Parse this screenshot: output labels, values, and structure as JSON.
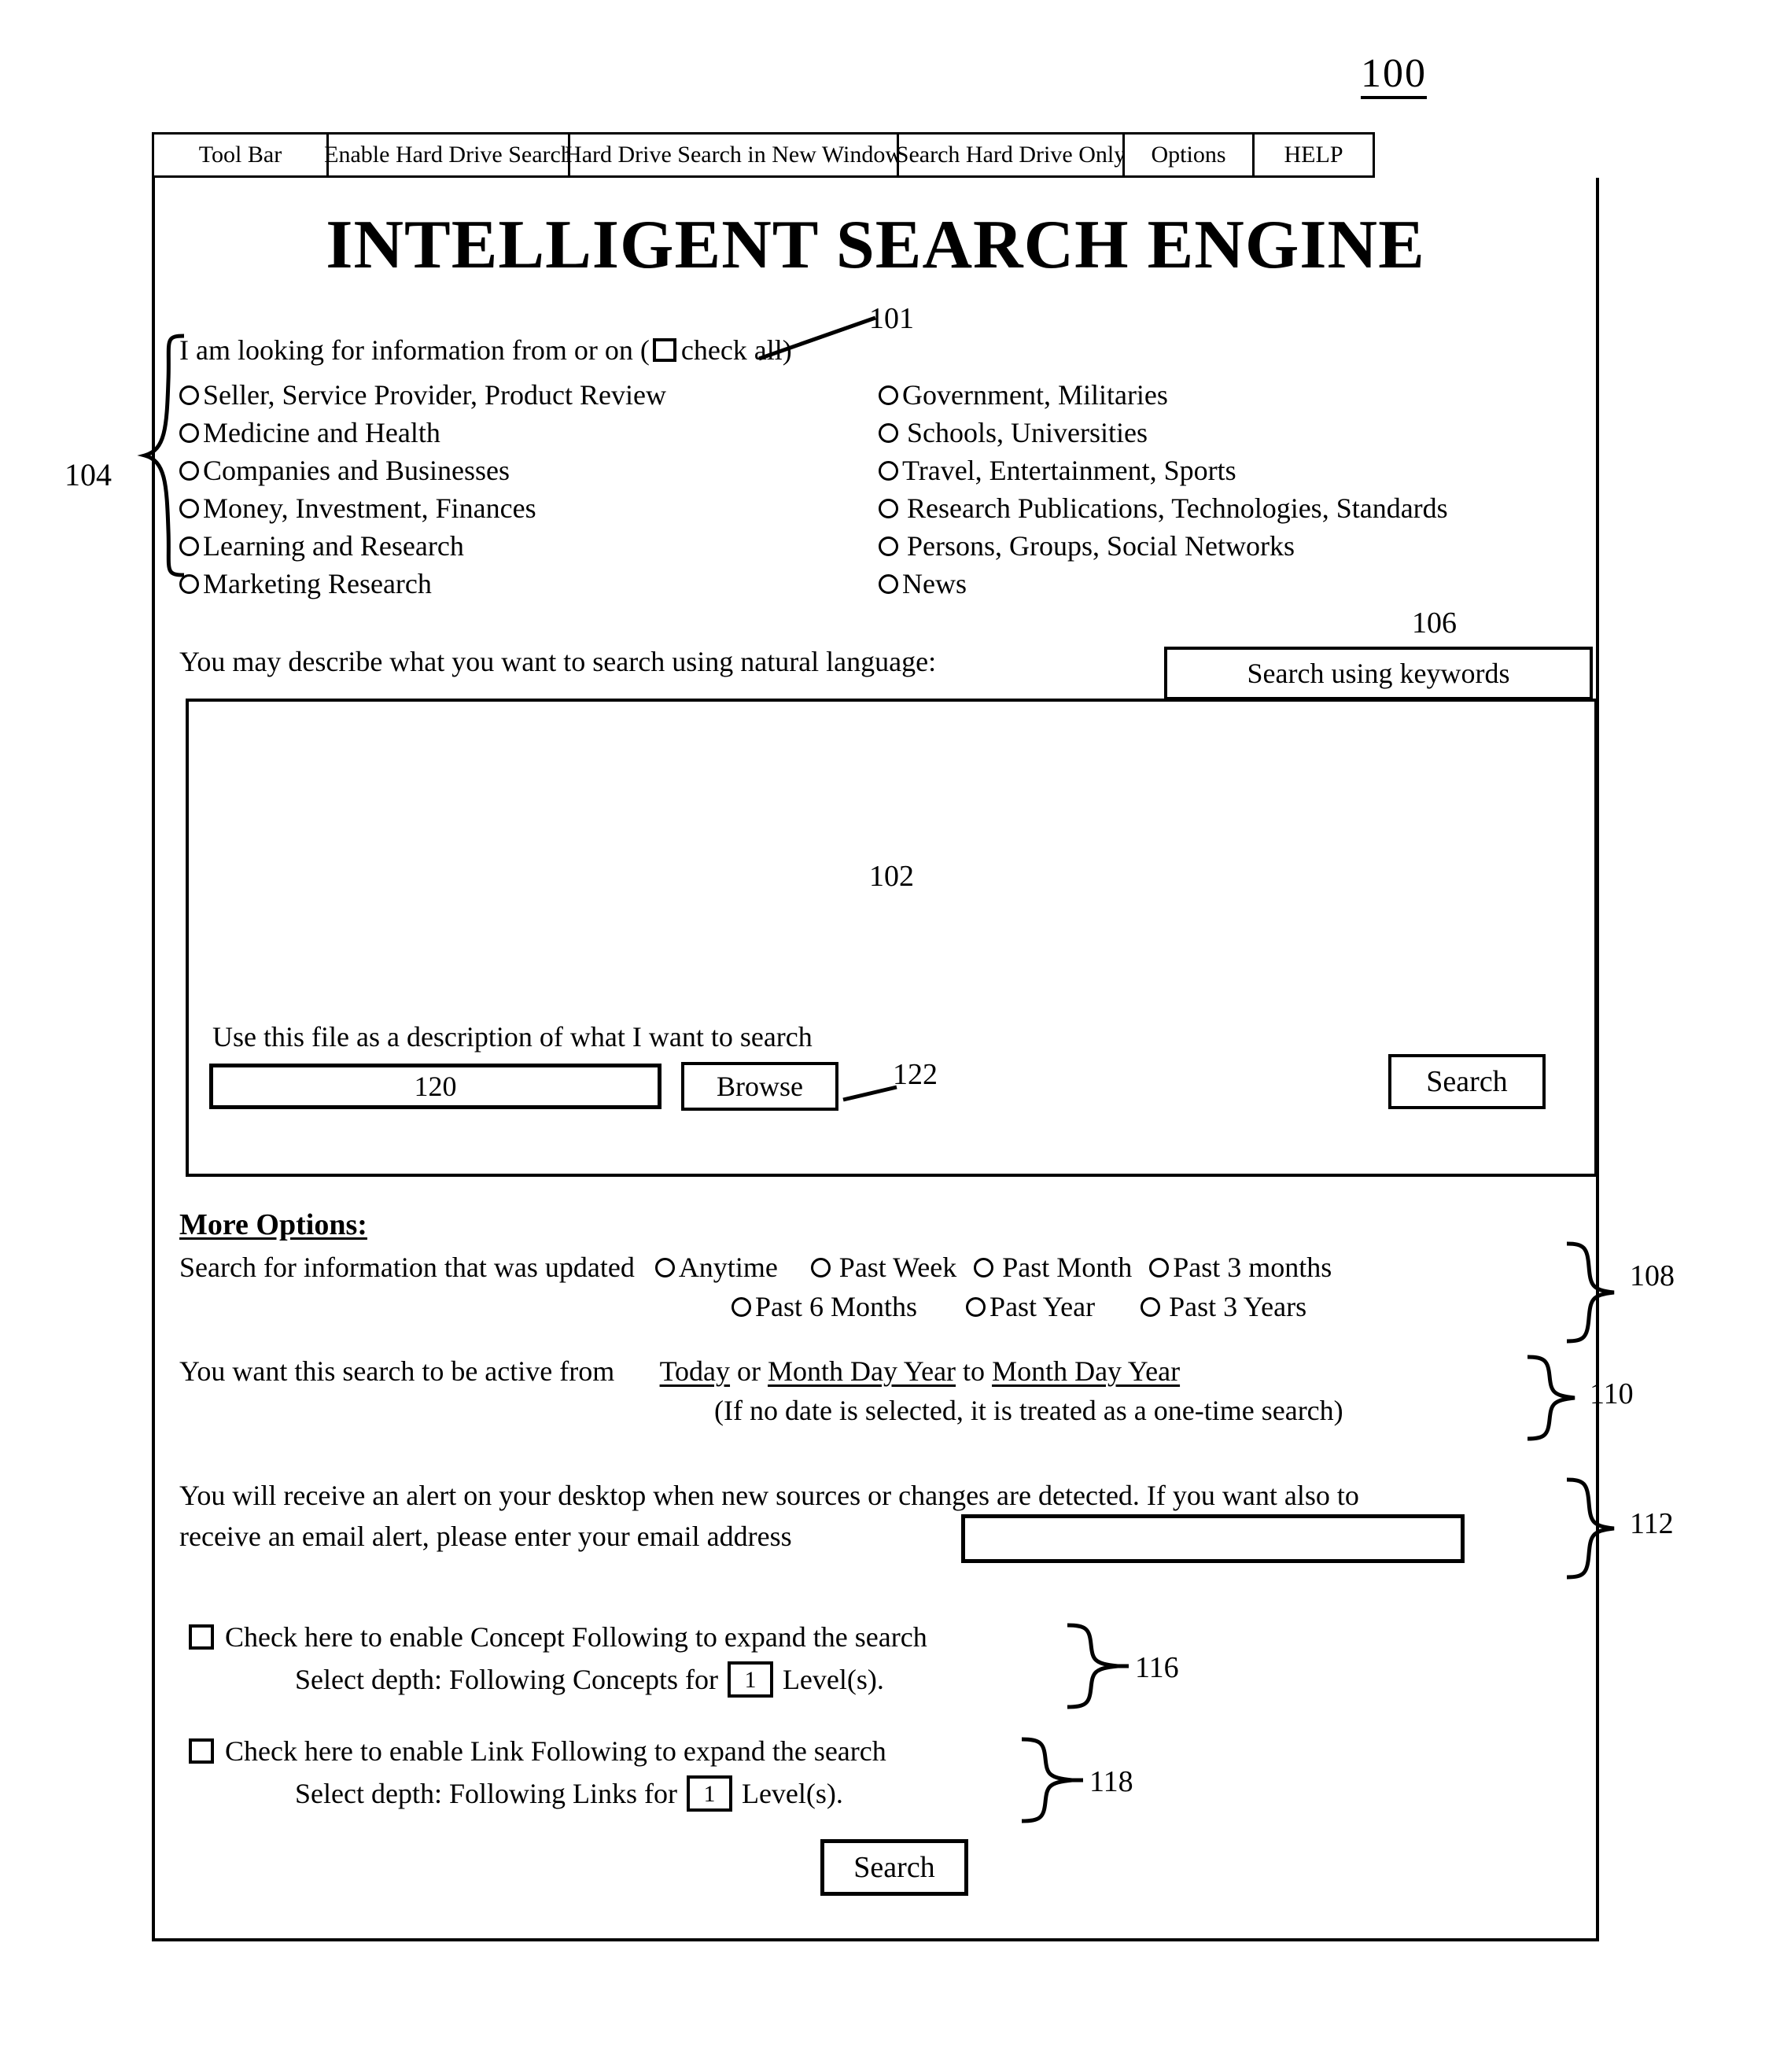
{
  "figure": {
    "number": "100"
  },
  "toolbar": {
    "items": [
      {
        "label": "Tool Bar"
      },
      {
        "label": "Enable Hard Drive Search"
      },
      {
        "label": "Hard Drive Search in New Window"
      },
      {
        "label": "Search Hard Drive Only"
      },
      {
        "label": "Options"
      },
      {
        "label": "HELP"
      }
    ]
  },
  "app": {
    "title": "INTELLIGENT SEARCH ENGINE"
  },
  "categories": {
    "ref": "104",
    "intro_before": "I am looking for information from or on (",
    "intro_after": "check all)",
    "checkall_ref": "101",
    "left": [
      "Seller, Service Provider, Product Review",
      "Medicine and Health",
      "Companies and Businesses",
      "Money, Investment, Finances",
      "Learning and Research",
      "Marketing Research"
    ],
    "right": [
      "Government, Militaries",
      "Schools, Universities",
      "Travel, Entertainment, Sports",
      "Research Publications, Technologies, Standards",
      "Persons, Groups, Social Networks",
      "News"
    ]
  },
  "natural_language": {
    "label": "You may describe what you want to search using natural language:",
    "keywords_button": "Search using keywords",
    "keywords_ref": "106",
    "textarea_ref": "102",
    "file_label": "Use this file as a description of what I want to search",
    "file_input_value": "120",
    "browse_button": "Browse",
    "browse_ref": "122",
    "search_button": "Search"
  },
  "more_options": {
    "heading": "More Options:",
    "updated": {
      "ref": "108",
      "label": "Search for information that was updated",
      "row1": [
        "Anytime",
        "Past Week",
        "Past Month",
        "Past 3 months"
      ],
      "row2": [
        "Past 6 Months",
        "Past Year",
        "Past 3 Years"
      ]
    },
    "active": {
      "ref": "110",
      "label": "You want this search to be active from",
      "today": "Today",
      "or": " or ",
      "from_date": "Month  Day  Year",
      "to": " to ",
      "to_date": "Month Day Year",
      "note": "(If no date is selected, it is treated as a one-time search)"
    },
    "alert": {
      "ref": "112",
      "line1": "You will receive an alert on your desktop when new sources or changes are detected. If you want also to",
      "line2": "receive an email alert, please enter your email address",
      "email_value": ""
    },
    "concept_following": {
      "ref": "116",
      "checkbox_label": "Check here to enable Concept Following to expand the search",
      "depth_prefix": "Select depth: Following Concepts for",
      "depth_value": "1",
      "depth_suffix": "Level(s)."
    },
    "link_following": {
      "ref": "118",
      "checkbox_label": "Check here to enable Link Following to expand the search",
      "depth_prefix": "Select depth: Following Links for",
      "depth_value": "1",
      "depth_suffix": "Level(s)."
    }
  },
  "bottom": {
    "search_button": "Search"
  }
}
